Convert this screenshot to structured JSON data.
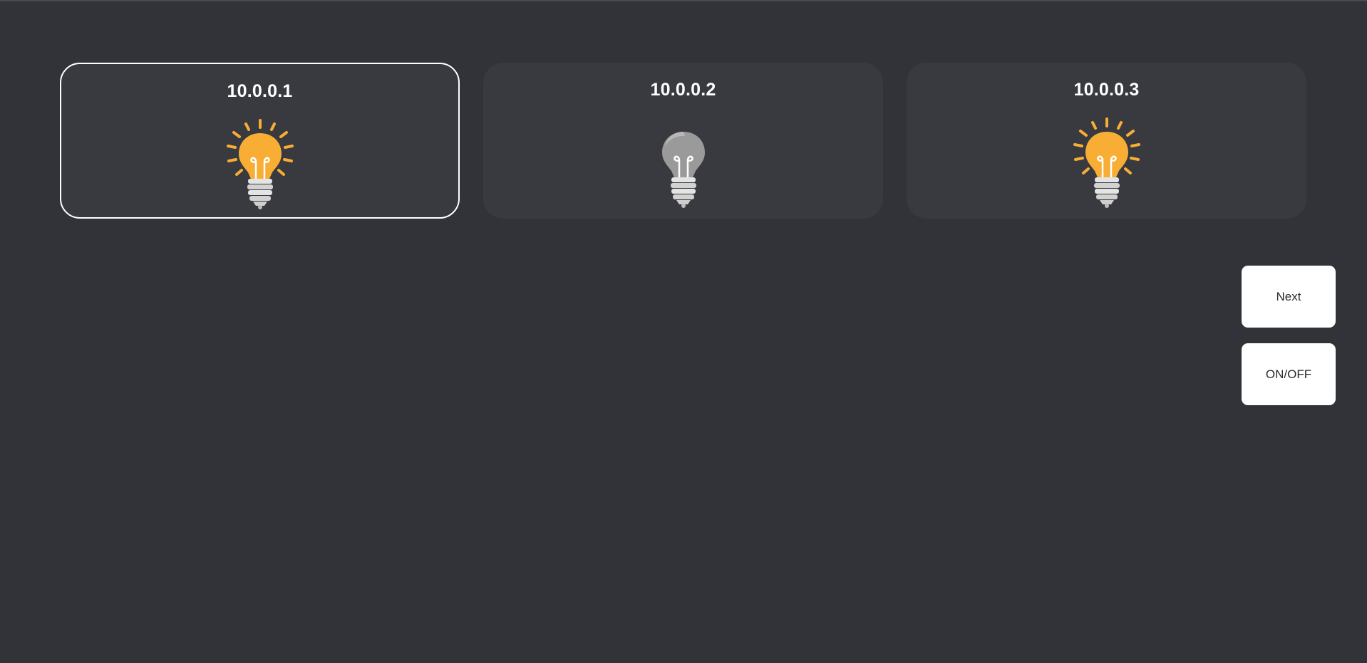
{
  "devices": [
    {
      "label": "10.0.0.1",
      "state": "on",
      "selected": true,
      "icon": "lightbulb-on-icon"
    },
    {
      "label": "10.0.0.2",
      "state": "off",
      "selected": false,
      "icon": "lightbulb-off-icon"
    },
    {
      "label": "10.0.0.3",
      "state": "on",
      "selected": false,
      "icon": "lightbulb-on-icon"
    }
  ],
  "controls": {
    "next_label": "Next",
    "onoff_label": "ON/OFF"
  },
  "colors": {
    "background": "#323338",
    "card": "#393a40",
    "bulb_on": "#F8AE35",
    "bulb_off": "#9a9a9a",
    "rays": "#F8AE35",
    "selection_border": "#ffffff"
  }
}
